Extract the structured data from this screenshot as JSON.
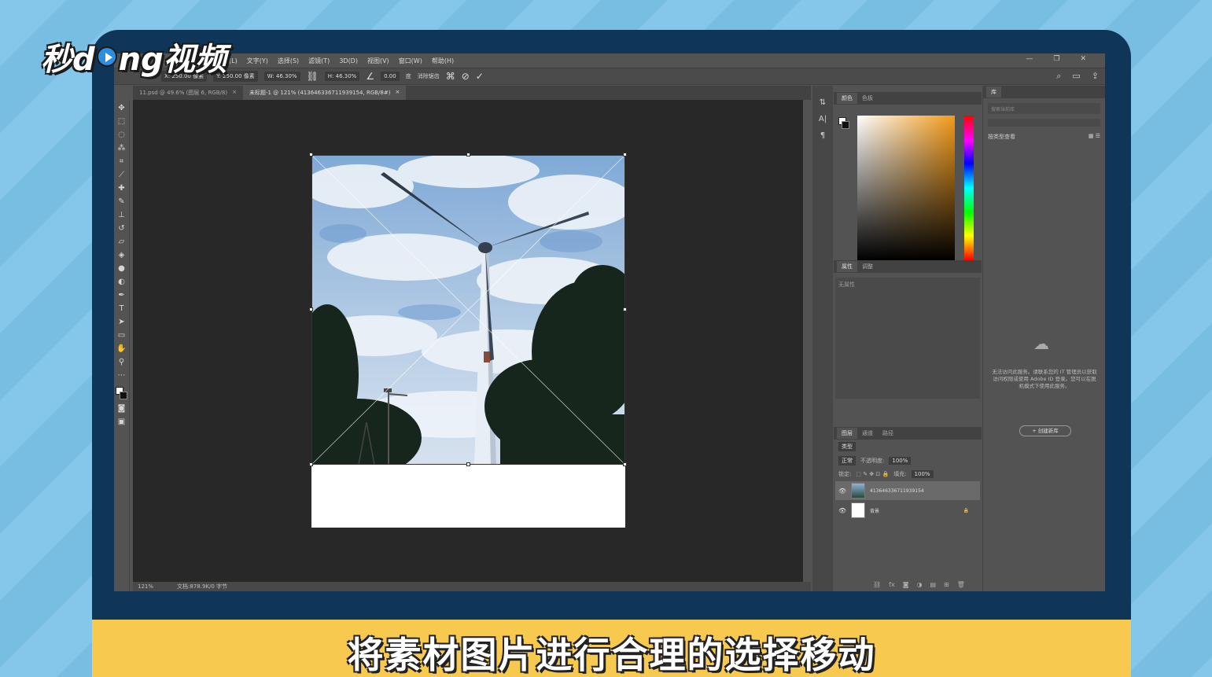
{
  "watermark": {
    "brand": "秒dong视频"
  },
  "photoshop": {
    "menu": [
      "图层(L)",
      "文字(Y)",
      "选择(S)",
      "滤镜(T)",
      "3D(D)",
      "视图(V)",
      "窗口(W)",
      "帮助(H)"
    ],
    "window_controls": [
      "—",
      "❐",
      "✕"
    ],
    "options": {
      "x": "X: 250.00 像素",
      "y": "Y: 250.00 像素",
      "w": "W: 46.30%",
      "h": "H: 46.30%",
      "angle": "0.00",
      "interp": "度",
      "antialias": "消除锯齿"
    },
    "tabs": [
      {
        "label": "11.psd @ 49.6% (图层 6, RGB/8)",
        "close": "×"
      },
      {
        "label": "未标题-1 @ 121% (413646336711939154, RGB/8#)",
        "close": "×"
      }
    ],
    "status": {
      "zoom": "121%",
      "doc": "文档:878.9K/0 字节"
    },
    "color_panel": {
      "tabs": [
        "颜色",
        "色板"
      ]
    },
    "props_panel": {
      "tabs": [
        "属性",
        "调整"
      ],
      "empty_text": "无属性"
    },
    "layers_panel": {
      "tabs": [
        "图层",
        "通道",
        "路径"
      ],
      "filter_label": "类型",
      "blend_mode": "正常",
      "opacity_label": "不透明度:",
      "opacity_value": "100%",
      "lock_label": "锁定:",
      "fill_label": "填充:",
      "fill_value": "100%",
      "layers": [
        {
          "name": "413646336711939154",
          "selected": true
        },
        {
          "name": "背景",
          "selected": false,
          "lock": "🔒"
        }
      ]
    },
    "library_panel": {
      "tab": "库",
      "search_placeholder": "搜索当前库",
      "sort_label": "按类型查看",
      "message": "无法访问此服务。请联系您的 IT 管理员以获取访问权限或使用 Adobe ID 登录。您可以在脱机模式下使用此服务。",
      "button": "+ 创建新库"
    }
  },
  "caption": "将素材图片进行合理的选择移动",
  "colors": {
    "caption_bg": "#f7c94f",
    "monitor": "#0f3558",
    "ps_dark": "#282828"
  }
}
